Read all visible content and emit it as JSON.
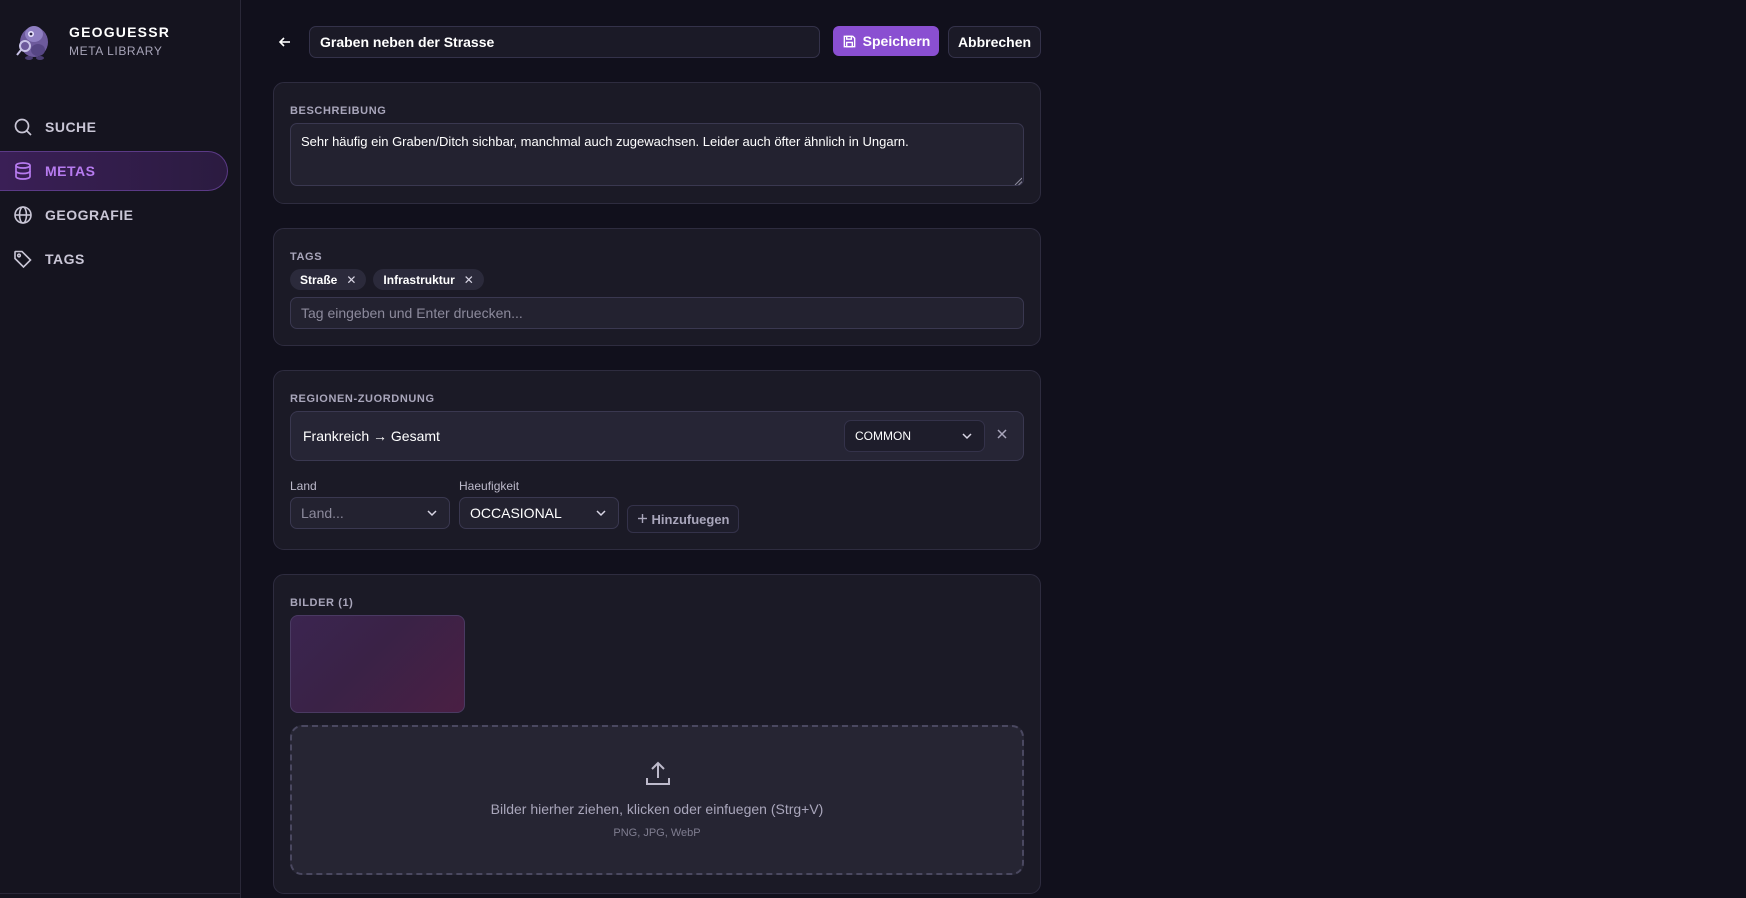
{
  "brand": {
    "title": "GEOGUESSR",
    "subtitle": "META LIBRARY"
  },
  "nav": {
    "items": [
      {
        "label": "SUCHE",
        "icon": "search-icon"
      },
      {
        "label": "METAS",
        "icon": "database-icon",
        "active": true
      },
      {
        "label": "GEOGRAFIE",
        "icon": "globe-icon"
      },
      {
        "label": "TAGS",
        "icon": "tag-icon"
      }
    ]
  },
  "toolbar": {
    "title_value": "Graben neben der Strasse",
    "save_label": "Speichern",
    "cancel_label": "Abbrechen"
  },
  "description": {
    "label": "BESCHREIBUNG",
    "value": "Sehr häufig ein Graben/Ditch sichbar, manchmal auch zugewachsen. Leider auch öfter ähnlich in Ungarn."
  },
  "tags": {
    "label": "TAGS",
    "items": [
      "Straße",
      "Infrastruktur"
    ],
    "remove_glyph": "✕",
    "input_placeholder": "Tag eingeben und Enter druecken..."
  },
  "regions": {
    "label": "REGIONEN-ZUORDNUNG",
    "assignments": [
      {
        "name": "Frankreich → Gesamt",
        "frequency": "COMMON"
      }
    ],
    "land_label": "Land",
    "land_placeholder": "Land...",
    "frequency_label": "Haeufigkeit",
    "frequency_value": "OCCASIONAL",
    "add_label": "Hinzufuegen"
  },
  "images": {
    "label": "BILDER (1)",
    "dropzone_text": "Bilder hierher ziehen, klicken oder einfuegen (Strg+V)",
    "dropzone_formats": "PNG, JPG, WebP"
  },
  "colors": {
    "accent": "#8a4fd1",
    "active_nav_text": "#b77bf0",
    "background": "#11101c",
    "card": "#1b1a26"
  }
}
